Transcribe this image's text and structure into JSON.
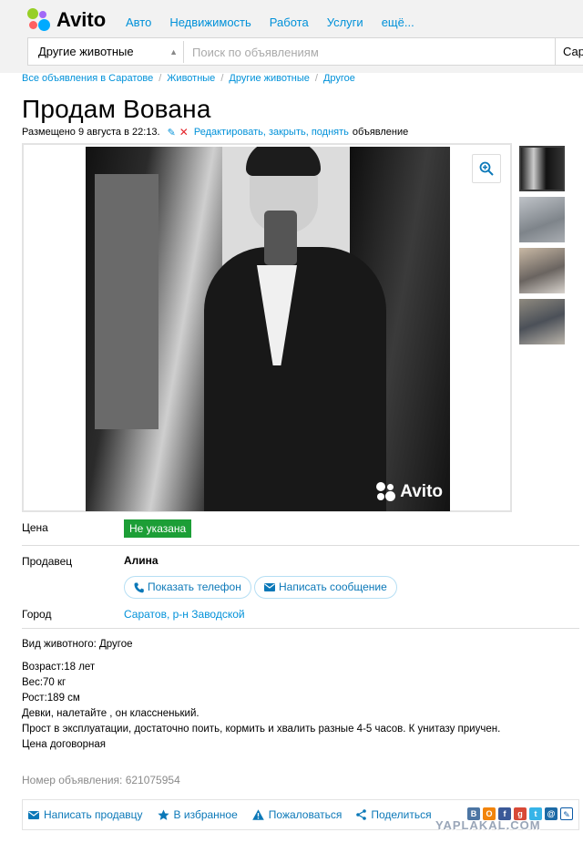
{
  "header": {
    "logo_text": "Avito",
    "nav": [
      "Авто",
      "Недвижимость",
      "Работа",
      "Услуги",
      "ещё..."
    ],
    "category_select": "Другие животные",
    "search_placeholder": "Поиск по объявлениям",
    "city_select": "Сара"
  },
  "breadcrumb": [
    "Все объявления в Саратове",
    "Животные",
    "Другие животные",
    "Другое"
  ],
  "listing": {
    "title": "Продам Вована",
    "posted": "Размещено 9 августа в 22:13.",
    "edit_link": "Редактировать, закрыть, поднять",
    "edit_suffix": "объявление",
    "watermark": "Avito"
  },
  "params": {
    "price_label": "Цена",
    "price_value": "Не указана",
    "seller_label": "Продавец",
    "seller_name": "Алина",
    "show_phone": "Показать телефон",
    "write_message": "Написать сообщение",
    "city_label": "Город",
    "city_value": "Саратов, р-н Заводской"
  },
  "description": {
    "animal_type": "Вид животного: Другое",
    "lines": [
      "Возраст:18 лет",
      "Вес:70 кг",
      "Рост:189 см",
      "Девки, налетайте , он классненький.",
      "Прост в эксплуатации, достаточно поить, кормить и хвалить разные 4-5 часов. К унитазу приучен.",
      "Цена договорная"
    ]
  },
  "ad_number": "Номер объявления: 621075954",
  "actions": {
    "write_seller": "Написать продавцу",
    "favorite": "В избранное",
    "complain": "Пожаловаться",
    "share": "Поделиться"
  },
  "site_watermark": "YAPLAKAL.COM",
  "colors": {
    "link": "#0091d9",
    "price_badge": "#1c9e36",
    "logo_dots": [
      "#97cf26",
      "#a169f7",
      "#ff6163",
      "#00aaff"
    ]
  }
}
